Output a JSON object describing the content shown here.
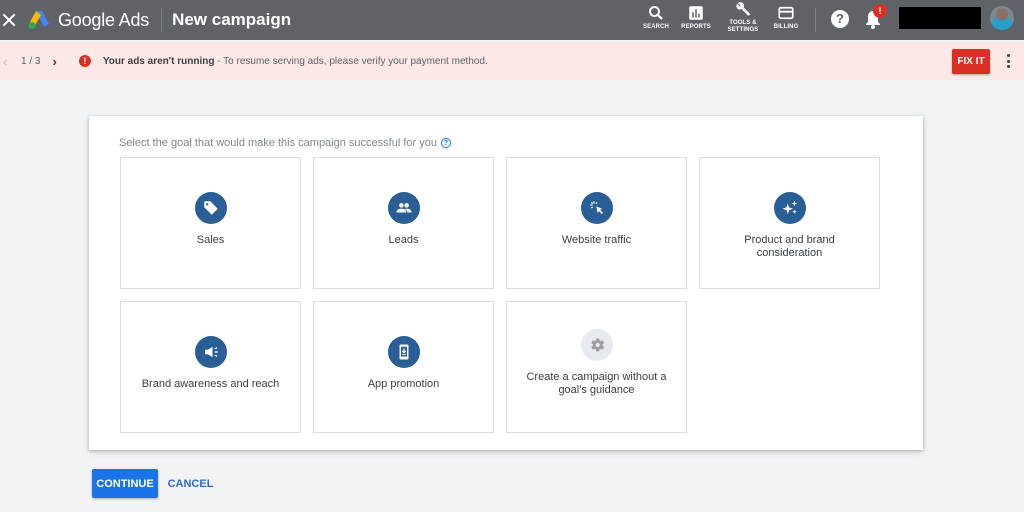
{
  "header": {
    "close_icon": "close-icon",
    "brand": "Google Ads",
    "page_title": "New campaign",
    "actions": [
      {
        "label": "SEARCH",
        "icon": "search-icon"
      },
      {
        "label": "REPORTS",
        "icon": "bar-chart-icon"
      },
      {
        "label_line1": "TOOLS &",
        "label_line2": "SETTINGS",
        "icon": "wrench-icon"
      },
      {
        "label": "BILLING",
        "icon": "credit-card-icon"
      }
    ],
    "help": "?",
    "notification_badge": "!"
  },
  "alert": {
    "pager": "1 / 3",
    "prev": "‹",
    "next": "›",
    "error_glyph": "!",
    "title": "Your ads aren't running",
    "message": " - To resume serving ads, please verify your payment method.",
    "fix_label": "FIX IT"
  },
  "main": {
    "prompt": "Select the goal that would make this campaign successful for you",
    "help_glyph": "?",
    "goals": [
      {
        "label": "Sales",
        "icon": "tag-icon"
      },
      {
        "label": "Leads",
        "icon": "people-icon"
      },
      {
        "label": "Website traffic",
        "icon": "cursor-click-icon"
      },
      {
        "label": "Product and brand consideration",
        "icon": "sparkle-icon"
      },
      {
        "label": "Brand awareness and reach",
        "icon": "megaphone-icon"
      },
      {
        "label": "App promotion",
        "icon": "mobile-download-icon"
      },
      {
        "label": "Create a campaign without a goal's guidance",
        "icon": "gear-icon"
      }
    ]
  },
  "footer": {
    "continue_label": "CONTINUE",
    "cancel_label": "CANCEL"
  },
  "colors": {
    "topbar": "#5f6368",
    "alert_bg": "#fce8e6",
    "error": "#d93025",
    "primary": "#1a73e8",
    "goal_icon": "#2a5e96"
  }
}
